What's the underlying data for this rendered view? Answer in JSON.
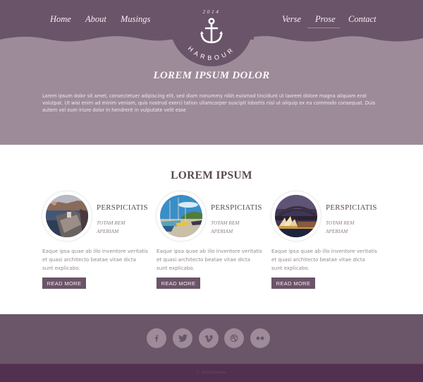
{
  "colors": {
    "header_dark": "#6a5469",
    "hero_bg": "#9d8b99",
    "footer_bg": "#6b5568",
    "bottom_bar": "#52304f",
    "button_bg": "#6b5468"
  },
  "nav": {
    "left": [
      {
        "label": "Home"
      },
      {
        "label": "About"
      },
      {
        "label": "Musings"
      }
    ],
    "right": [
      {
        "label": "Verse"
      },
      {
        "label": "Prose",
        "active": true
      },
      {
        "label": "Contact"
      }
    ]
  },
  "logo": {
    "year": "2014",
    "name": "HARBOUR",
    "icon": "anchor-icon"
  },
  "hero": {
    "title": "LOREM IPSUM DOLOR",
    "text": "Lorem ipsum dolor sit amet, consectetuer adipiscing elit, sed diam nonummy nibh euismod tincidunt ut laoreet dolore magna aliquam erat volutpat. Ut wisi enim ad minim veniam, quis nostrud exerci tation ullamcorper suscipit lobortis nisl ut aliquip ex ea commodo consequat. Duis autem vel eum iriure dolor in hendrerit in vulputate velit esse"
  },
  "main": {
    "title": "LOREM IPSUM",
    "cards": [
      {
        "image": "harbour-ship-photo",
        "title": "PERSPICIATIS",
        "subtitle": "TOTAM REM APERIAM",
        "text": "Eaque ipsa quae ab illo inventore veritatis et quasi architecto beatae vitae dicta sunt explicabo.",
        "button": "READ MORE"
      },
      {
        "image": "beach-boats-photo",
        "title": "PERSPICIATIS",
        "subtitle": "TOTAM REM APERIAM",
        "text": "Eaque ipsa quae ab illo inventore veritatis et quasi architecto beatae vitae dicta sunt explicabo.",
        "button": "READ MORE"
      },
      {
        "image": "sydney-opera-house-photo",
        "title": "PERSPICIATIS",
        "subtitle": "TOTAM REM APERIAM",
        "text": "Eaque ipsa quae ab illo inventore veritatis et quasi architecto beatae vitae dicta sunt explicabo.",
        "button": "READ MORE"
      }
    ]
  },
  "footer": {
    "social": [
      {
        "name": "facebook",
        "icon": "facebook-icon"
      },
      {
        "name": "twitter",
        "icon": "twitter-icon"
      },
      {
        "name": "vimeo",
        "icon": "vimeo-icon"
      },
      {
        "name": "dribbble",
        "icon": "dribbble-icon"
      },
      {
        "name": "flickr",
        "icon": "flickr-icon"
      }
    ],
    "copyright": "© 2014 Harbour"
  }
}
